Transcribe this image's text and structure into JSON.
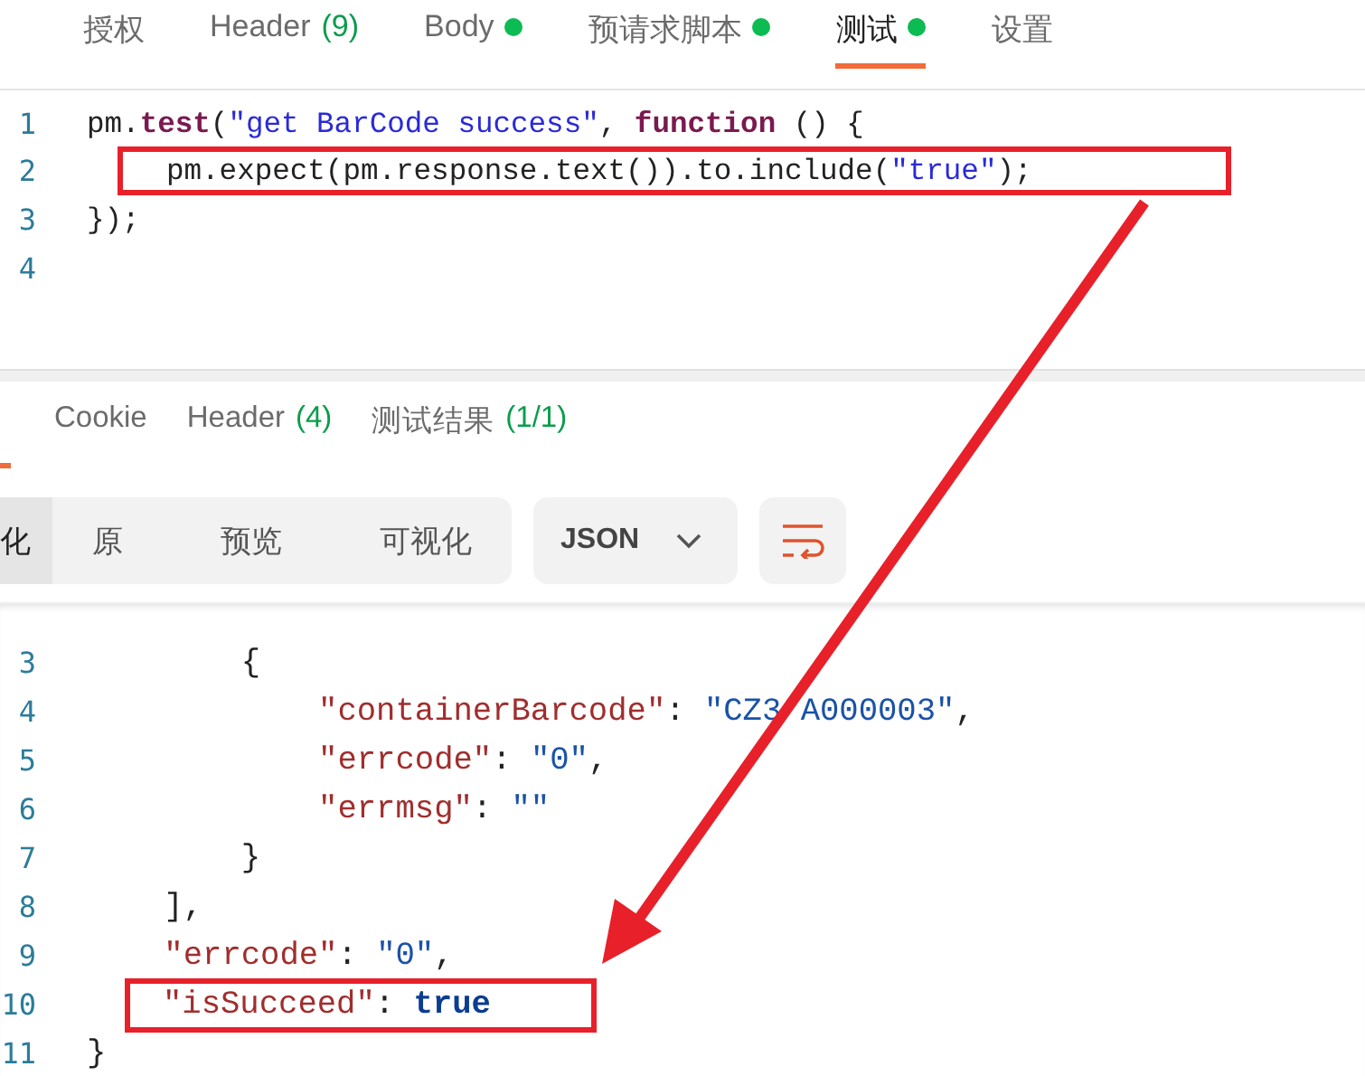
{
  "request_tabs": [
    {
      "label": "授权",
      "selected": false,
      "dot": false
    },
    {
      "label": "Header",
      "count": "(9)",
      "selected": false,
      "dot": false
    },
    {
      "label": "Body",
      "selected": false,
      "dot": true
    },
    {
      "label": "预请求脚本",
      "selected": false,
      "dot": true
    },
    {
      "label": "测试",
      "selected": true,
      "dot": true
    },
    {
      "label": "设置",
      "selected": false,
      "dot": false
    }
  ],
  "test_editor": {
    "lines": [
      {
        "number": "1",
        "tokens": [
          {
            "kind": "plain",
            "text": "pm."
          },
          {
            "kind": "keyword",
            "text": "test"
          },
          {
            "kind": "plain",
            "text": "("
          },
          {
            "kind": "string",
            "text": "\"get BarCode success\""
          },
          {
            "kind": "plain",
            "text": ", "
          },
          {
            "kind": "keyword",
            "text": "function"
          },
          {
            "kind": "plain",
            "text": " () {"
          }
        ]
      },
      {
        "number": "2",
        "highlighted": true,
        "tokens": [
          {
            "kind": "plain",
            "text": "pm.expect(pm.response.text()).to.include("
          },
          {
            "kind": "string",
            "text": "\"true\""
          },
          {
            "kind": "plain",
            "text": ");"
          }
        ]
      },
      {
        "number": "3",
        "tokens": [
          {
            "kind": "plain",
            "text": "});"
          }
        ]
      },
      {
        "number": "4"
      }
    ]
  },
  "response_tabs": [
    {
      "label": "Cookie",
      "selected": false
    },
    {
      "label": "Header",
      "count": "(4)",
      "selected": false
    },
    {
      "label": "测试结果",
      "count": "(1/1)",
      "selected": false
    }
  ],
  "format_tabs": [
    {
      "label": "化",
      "selected": true
    },
    {
      "label": "原",
      "selected": false
    },
    {
      "label": "预览",
      "selected": false
    },
    {
      "label": "可视化",
      "selected": false
    }
  ],
  "format_dropdown": {
    "value": "JSON"
  },
  "response_body": {
    "lines": [
      {
        "number": "3",
        "tokens": [
          {
            "kind": "plain",
            "text": "        {"
          }
        ]
      },
      {
        "number": "4",
        "tokens": [
          {
            "kind": "key",
            "text": "            \"containerBarcode\""
          },
          {
            "kind": "plain",
            "text": ": "
          },
          {
            "kind": "value",
            "text": "\"CZ3"
          },
          {
            "kind": "covered"
          },
          {
            "kind": "value",
            "text": "A000003\""
          },
          {
            "kind": "plain",
            "text": ","
          }
        ]
      },
      {
        "number": "5",
        "tokens": [
          {
            "kind": "key",
            "text": "            \"errcode\""
          },
          {
            "kind": "plain",
            "text": ": "
          },
          {
            "kind": "value",
            "text": "\"0\""
          },
          {
            "kind": "plain",
            "text": ","
          }
        ]
      },
      {
        "number": "6",
        "tokens": [
          {
            "kind": "key",
            "text": "            \"errmsg\""
          },
          {
            "kind": "plain",
            "text": ": "
          },
          {
            "kind": "value",
            "text": "\"\""
          }
        ]
      },
      {
        "number": "7",
        "tokens": [
          {
            "kind": "plain",
            "text": "        }"
          }
        ]
      },
      {
        "number": "8",
        "tokens": [
          {
            "kind": "plain",
            "text": "    ],"
          }
        ]
      },
      {
        "number": "9",
        "tokens": [
          {
            "kind": "key",
            "text": "    \"errcode\""
          },
          {
            "kind": "plain",
            "text": ": "
          },
          {
            "kind": "value",
            "text": "\"0\""
          },
          {
            "kind": "plain",
            "text": ","
          }
        ]
      },
      {
        "number": "10",
        "highlighted": true,
        "tokens": [
          {
            "kind": "key",
            "text": "\"isSucceed\""
          },
          {
            "kind": "plain",
            "text": ": "
          },
          {
            "kind": "bool",
            "text": "true"
          }
        ]
      },
      {
        "number": "11",
        "tokens": [
          {
            "kind": "plain",
            "text": "}"
          }
        ]
      }
    ]
  }
}
